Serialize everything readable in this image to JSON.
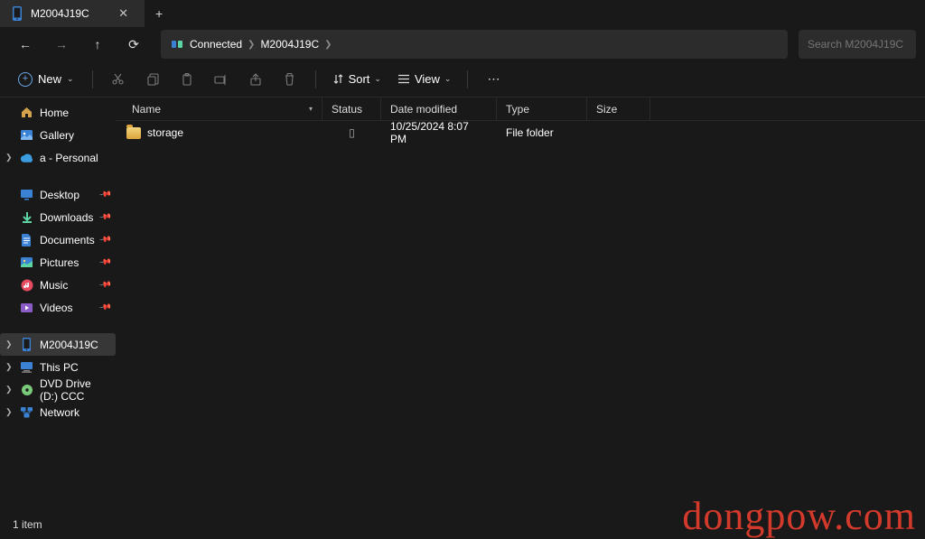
{
  "tab": {
    "title": "M2004J19C"
  },
  "breadcrumb": {
    "parts": [
      "Connected",
      "M2004J19C"
    ]
  },
  "search": {
    "placeholder": "Search M2004J19C"
  },
  "toolbar": {
    "new_label": "New",
    "sort_label": "Sort",
    "view_label": "View"
  },
  "sidebar": {
    "quick": [
      {
        "label": "Home",
        "icon": "home"
      },
      {
        "label": "Gallery",
        "icon": "gallery"
      },
      {
        "label": "a - Personal",
        "icon": "cloud",
        "expand": true
      }
    ],
    "user": [
      {
        "label": "Desktop",
        "icon": "desktop",
        "pin": true
      },
      {
        "label": "Downloads",
        "icon": "down",
        "pin": true
      },
      {
        "label": "Documents",
        "icon": "doc",
        "pin": true
      },
      {
        "label": "Pictures",
        "icon": "pic",
        "pin": true
      },
      {
        "label": "Music",
        "icon": "music",
        "pin": true
      },
      {
        "label": "Videos",
        "icon": "video",
        "pin": true
      }
    ],
    "drives": [
      {
        "label": "M2004J19C",
        "icon": "phone",
        "expand": true,
        "selected": true
      },
      {
        "label": "This PC",
        "icon": "pc",
        "expand": true
      },
      {
        "label": "DVD Drive (D:) CCC",
        "icon": "dvd",
        "expand": true
      },
      {
        "label": "Network",
        "icon": "net",
        "expand": true
      }
    ]
  },
  "columns": {
    "name": "Name",
    "status": "Status",
    "date": "Date modified",
    "type": "Type",
    "size": "Size"
  },
  "rows": [
    {
      "name": "storage",
      "status": "▯",
      "date": "10/25/2024 8:07 PM",
      "type": "File folder",
      "size": ""
    }
  ],
  "statusbar": {
    "text": "1 item"
  },
  "watermark": "dongpow.com"
}
